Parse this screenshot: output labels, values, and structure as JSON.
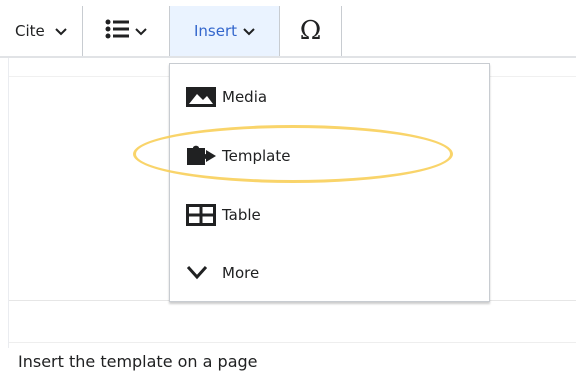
{
  "toolbar": {
    "cite_label": "Cite",
    "cite_icon": "chevron-down-icon",
    "list_icon": "bullet-list-icon",
    "insert_label": "Insert",
    "special_char_label": "Ω"
  },
  "insert_menu": {
    "items": [
      {
        "label": "Media",
        "icon": "image-icon"
      },
      {
        "label": "Template",
        "icon": "puzzle-icon"
      },
      {
        "label": "Table",
        "icon": "table-icon"
      },
      {
        "label": "More",
        "icon": "chevron-down-icon"
      }
    ]
  },
  "caption": "Insert the template on a page",
  "colors": {
    "accent": "#3366cc",
    "highlight": "#f8cf5a",
    "active_bg": "#eaf3ff",
    "border": "#c8ccd1"
  }
}
